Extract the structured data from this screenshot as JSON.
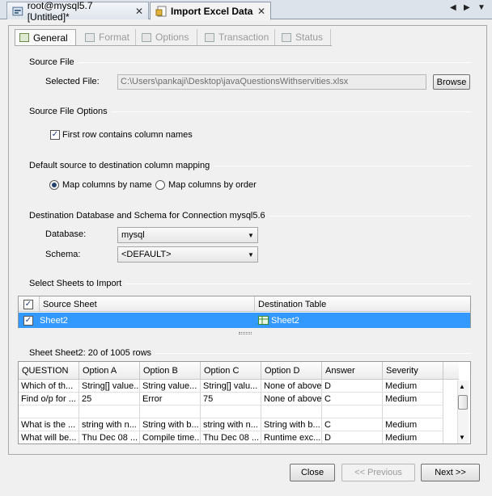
{
  "editor_tabs": [
    {
      "label": "root@mysql5.7 [Untitled]*",
      "close": "✕",
      "icon": "database-icon"
    },
    {
      "label": "Import Excel Data",
      "close": "✕",
      "icon": "import-icon"
    }
  ],
  "nav_arrows": {
    "left": "◀",
    "right": "▶",
    "menu": "▼"
  },
  "wizard_tabs": [
    "General",
    "Format",
    "Options",
    "Transaction",
    "Status"
  ],
  "source_file": {
    "section": "Source File",
    "label": "Selected File:",
    "value": "C:\\Users\\pankaji\\Desktop\\javaQuestionsWithservities.xlsx",
    "browse": "Browse"
  },
  "file_options": {
    "section": "Source File Options",
    "first_row_label": "First row contains column names",
    "first_row_checked": true
  },
  "mapping": {
    "section": "Default source to destination column mapping",
    "by_name": "Map columns by name",
    "by_order": "Map columns by order",
    "selected": "by_name"
  },
  "destination": {
    "section": "Destination Database and Schema for Connection mysql5.6",
    "database_label": "Database:",
    "database_value": "mysql",
    "schema_label": "Schema:",
    "schema_value": "<DEFAULT>"
  },
  "sheets": {
    "section": "Select Sheets to Import",
    "headers": [
      "Source Sheet",
      "Destination Table"
    ],
    "rows": [
      {
        "source": "Sheet2",
        "dest": "Sheet2",
        "checked": true
      }
    ]
  },
  "preview": {
    "section": "Sheet Sheet2: 20 of 1005 rows",
    "headers": [
      "QUESTION",
      "Option A",
      "Option B",
      "Option C",
      "Option D",
      "Answer",
      "Severity"
    ],
    "rows": [
      [
        "Which of th...",
        "String[] value...",
        "String value...",
        "String[] valu...",
        "None of above",
        "D",
        "Medium"
      ],
      [
        "Find o/p for ...",
        "25",
        "Error",
        "75",
        "None of above",
        "C",
        "Medium"
      ],
      [
        "",
        "",
        "",
        "",
        "",
        "",
        ""
      ],
      [
        "What is the ...",
        "string with n...",
        "String with b...",
        "string with n...",
        "String with b...",
        "C",
        "Medium"
      ],
      [
        "What will be...",
        "Thu Dec 08 ...",
        "Compile time...",
        "Thu Dec 08 ...",
        "Runtime exc...",
        "D",
        "Medium"
      ]
    ]
  },
  "buttons": {
    "close": "Close",
    "previous": "<< Previous",
    "next": "Next >>"
  },
  "colors": {
    "selection": "#3399ff",
    "panel": "#f0f0f0"
  }
}
